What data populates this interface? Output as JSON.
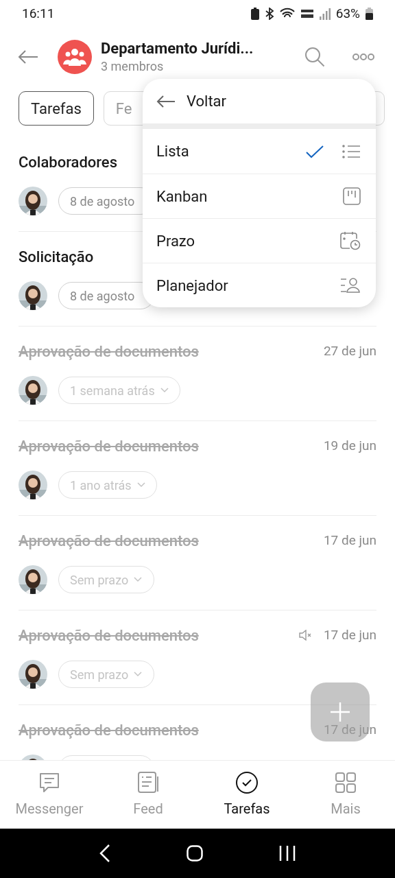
{
  "status_bar": {
    "time": "16:11",
    "battery": "63%"
  },
  "header": {
    "title": "Departamento Jurídi...",
    "subtitle": "3 membros"
  },
  "filters": [
    {
      "label": "Tarefas",
      "selected": true
    },
    {
      "label": "Fe",
      "selected": false
    },
    {
      "selected": false
    }
  ],
  "view_menu": {
    "back": "Voltar",
    "items": [
      {
        "label": "Lista",
        "kind": "list",
        "selected": true
      },
      {
        "label": "Kanban",
        "kind": "kanban",
        "selected": false
      },
      {
        "label": "Prazo",
        "kind": "deadline",
        "selected": false
      },
      {
        "label": "Planejador",
        "kind": "planner",
        "selected": false
      }
    ]
  },
  "sections": [
    {
      "title": "Colaboradores",
      "deadline": "8 de agosto"
    },
    {
      "title": "Solicitação",
      "deadline": "8 de agosto"
    }
  ],
  "tasks": [
    {
      "title": "Aprovação de documentos",
      "date": "27 de jun",
      "deadline": "1 semana atrás",
      "completed": true,
      "muted": false
    },
    {
      "title": "Aprovação de documentos",
      "date": "19 de jun",
      "deadline": "1 ano atrás",
      "completed": true,
      "muted": false
    },
    {
      "title": "Aprovação de documentos",
      "date": "17 de jun",
      "deadline": "Sem prazo",
      "completed": true,
      "muted": false
    },
    {
      "title": "Aprovação de documentos",
      "date": "17 de jun",
      "deadline": "Sem prazo",
      "completed": true,
      "muted": true
    },
    {
      "title": "Aprovação de documentos",
      "date": "17 de jun",
      "completed": true,
      "muted": false
    }
  ],
  "bottom_nav": [
    {
      "label": "Messenger",
      "kind": "chat",
      "selected": false
    },
    {
      "label": "Feed",
      "kind": "feed",
      "selected": false
    },
    {
      "label": "Tarefas",
      "kind": "tasks",
      "selected": true
    },
    {
      "label": "Mais",
      "kind": "more",
      "selected": false
    }
  ]
}
